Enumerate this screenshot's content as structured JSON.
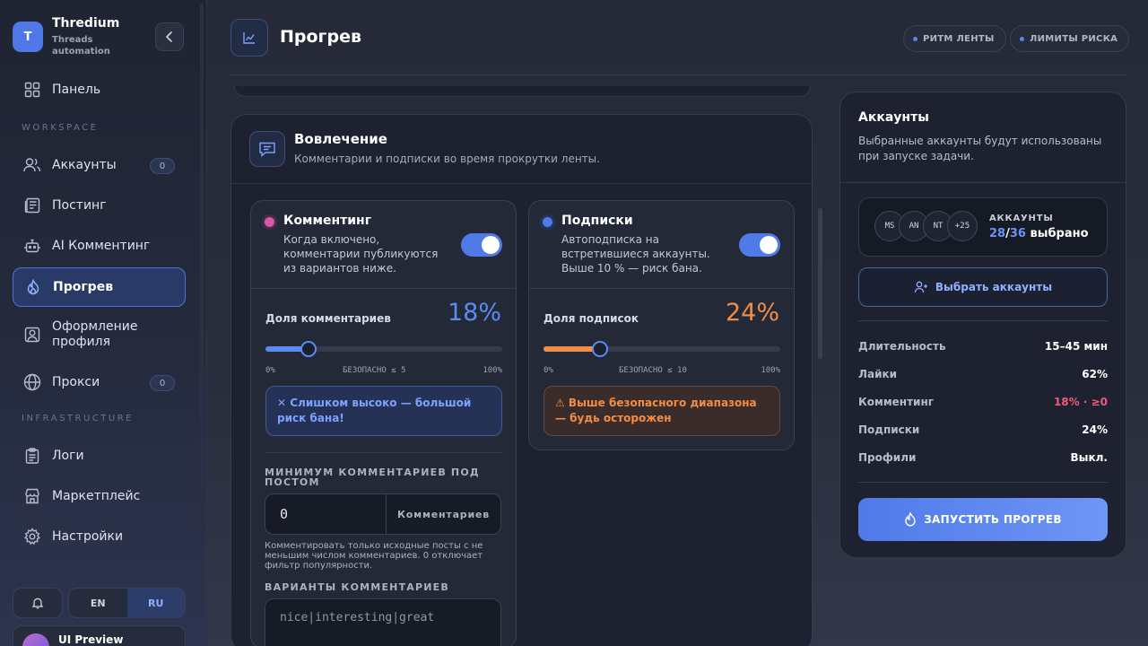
{
  "brand": {
    "logo_letter": "T",
    "name": "Thredium",
    "subtitle": "Threads automation"
  },
  "sidebar": {
    "dashboard": "Панель",
    "workspace_label": "WORKSPACE",
    "accounts": "Аккаунты",
    "accounts_badge": "0",
    "posting": "Постинг",
    "ai_commenting": "AI Комментинг",
    "warmup": "Прогрев",
    "profile_design": "Оформление профиля",
    "proxies": "Прокси",
    "proxies_badge": "0",
    "infrastructure_label": "INFRASTRUCTURE",
    "logs": "Логи",
    "marketplace": "Маркетплейс",
    "settings": "Настройки",
    "lang_en": "EN",
    "lang_ru": "RU",
    "user_name": "UI Preview"
  },
  "header": {
    "title": "Прогрев",
    "pill_rhythm": "РИТМ ЛЕНТЫ",
    "pill_limits": "ЛИМИТЫ РИСКА"
  },
  "engagement": {
    "title": "Вовлечение",
    "subtitle": "Комментарии и подписки во время прокрутки ленты.",
    "commenting": {
      "title": "Комментинг",
      "desc": "Когда включено, комментарии публикуются из вариантов ниже.",
      "enabled": true,
      "share_label": "Доля комментариев",
      "share_value": "18%",
      "share_fraction": 0.18,
      "scale_min": "0%",
      "scale_mid": "БЕЗОПАСНО ≤ 5",
      "scale_max": "100%",
      "alert": "✕ Слишком высоко — большой риск бана!"
    },
    "follows": {
      "title": "Подписки",
      "desc": "Автоподписка на встретившиеся аккаунты. Выше 10 % — риск бана.",
      "enabled": true,
      "share_label": "Доля подписок",
      "share_value": "24%",
      "share_fraction": 0.24,
      "scale_min": "0%",
      "scale_mid": "БЕЗОПАСНО ≤ 10",
      "scale_max": "100%",
      "alert": "⚠ Выше безопасного диапазона — будь осторожен"
    },
    "min_comments_label": "МИНИМУМ КОММЕНТАРИЕВ ПОД ПОСТОМ",
    "min_comments_value": "0",
    "min_comments_unit": "Комментариев",
    "min_comments_help": "Комментировать только исходные посты с не меньшим числом комментариев. 0 отключает фильтр популярности.",
    "variants_label": "ВАРИАНТЫ КОММЕНТАРИЕВ",
    "variants_value": "nice|interesting|great"
  },
  "accounts_panel": {
    "title": "Аккаунты",
    "subtitle": "Выбранные аккаунты будут использованы при запуске задачи.",
    "avatars": [
      "MS",
      "AN",
      "NT",
      "+25"
    ],
    "label": "АККАУНТЫ",
    "selected": "28",
    "total": "36",
    "selected_suffix": " выбрано",
    "pick_button": "Выбрать аккаунты",
    "stats": {
      "duration_k": "Длительность",
      "duration_v": "15–45 мин",
      "likes_k": "Лайки",
      "likes_v": "62%",
      "commenting_k": "Комментинг",
      "commenting_v": "18% · ≥0",
      "follows_k": "Подписки",
      "follows_v": "24%",
      "profiles_k": "Профили",
      "profiles_v": "Выкл."
    },
    "launch_button": "ЗАПУСТИТЬ ПРОГРЕВ"
  },
  "colors": {
    "accent": "#4f7ae8",
    "warn_orange": "#f38d45",
    "danger": "#ef5a7a",
    "comment_dot": "#d45aa8",
    "follow_dot": "#4f7ae8"
  }
}
